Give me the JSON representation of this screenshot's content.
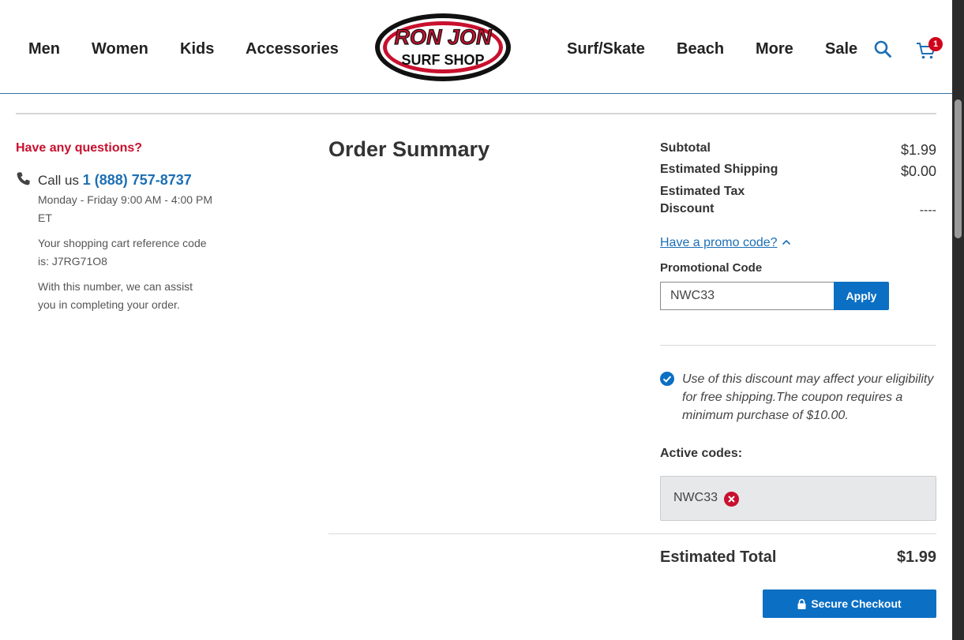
{
  "nav": {
    "left": [
      "Men",
      "Women",
      "Kids",
      "Accessories"
    ],
    "right": [
      "Surf/Skate",
      "Beach",
      "More",
      "Sale"
    ],
    "cart_count": "1"
  },
  "logo": {
    "line1": "RON JON",
    "line2": "SURF SHOP"
  },
  "help": {
    "title": "Have any questions?",
    "call_prefix": "Call us",
    "phone": "1 (888) 757-8737",
    "hours_line1": "Monday - Friday 9:00 AM - 4:00 PM",
    "hours_line2": "ET",
    "ref_line1": "Your shopping cart reference code",
    "ref_line2": "is: J7RG71O8",
    "assist_line1": "With this number, we can assist",
    "assist_line2": "you in completing your order."
  },
  "order": {
    "title": "Order Summary",
    "subtotal_label": "Subtotal",
    "subtotal_value": "$1.99",
    "shipping_label": "Estimated Shipping",
    "shipping_value": "$0.00",
    "tax_label": "Estimated Tax",
    "discount_label": "Discount",
    "discount_value": "----",
    "promo_link": "Have a promo code?",
    "promo_field_label": "Promotional Code",
    "promo_value": "NWC33",
    "apply_label": "Apply",
    "notice": "Use of this discount may affect your eligibility for free shipping.The coupon requires a minimum purchase of $10.00.",
    "active_label": "Active codes:",
    "active_code": "NWC33",
    "total_label": "Estimated Total",
    "total_value": "$1.99",
    "checkout_label": "Secure Checkout"
  },
  "colors": {
    "brand_blue": "#0b6fc4",
    "link_blue": "#1c6fb5",
    "alert_red": "#c8102e"
  }
}
